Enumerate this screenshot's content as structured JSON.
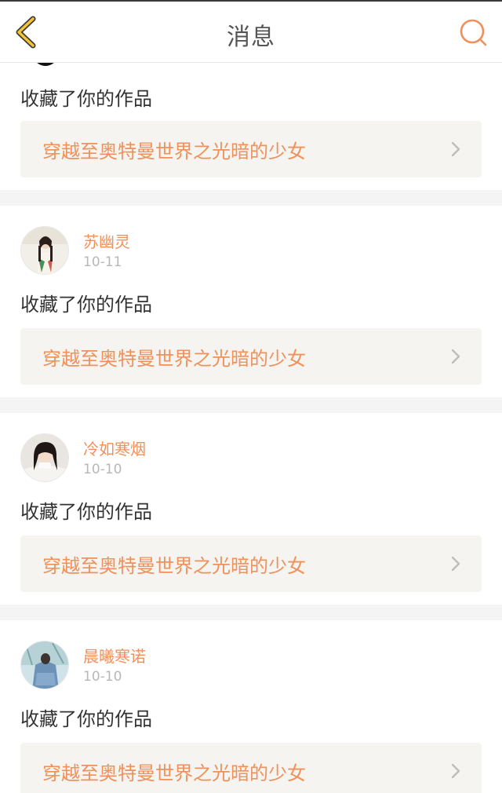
{
  "header": {
    "title": "消息",
    "back_icon": "chevron-left-icon",
    "search_icon": "search-icon",
    "accent_color": "#f0905a"
  },
  "notifications": [
    {
      "username": "",
      "date": "",
      "action": "收藏了你的作品",
      "work_title": "穿越至奥特曼世界之光暗的少女"
    },
    {
      "username": "苏幽灵",
      "date": "10-11",
      "action": "收藏了你的作品",
      "work_title": "穿越至奥特曼世界之光暗的少女"
    },
    {
      "username": "冷如寒烟",
      "date": "10-10",
      "action": "收藏了你的作品",
      "work_title": "穿越至奥特曼世界之光暗的少女"
    },
    {
      "username": "晨曦寒诺",
      "date": "10-10",
      "action": "收藏了你的作品",
      "work_title": "穿越至奥特曼世界之光暗的少女"
    }
  ]
}
